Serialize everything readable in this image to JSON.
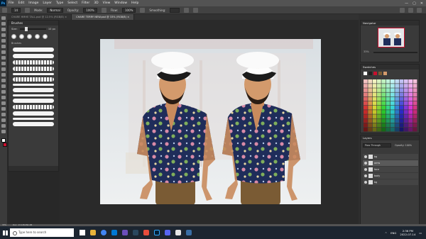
{
  "app": {
    "logo": "Ps",
    "menu": [
      "File",
      "Edit",
      "Image",
      "Layer",
      "Type",
      "Select",
      "Filter",
      "3D",
      "View",
      "Window",
      "Help"
    ],
    "window_controls": [
      "—",
      "▢",
      "✕"
    ]
  },
  "options_bar": {
    "size": "14",
    "mode_label": "Mode:",
    "mode_value": "Normal",
    "opacity_label": "Opacity:",
    "opacity_value": "100%",
    "flow_label": "Flow:",
    "flow_value": "100%",
    "smoothing_label": "Smoothing:"
  },
  "tabs": [
    {
      "label": "CHARE HMHE TALL.psd @ 12.5% (RGB/8) ×",
      "active": false
    },
    {
      "label": "CHARE TERRY NEW.psd @ 33% (RGB/8) ×",
      "active": true
    }
  ],
  "brushes_panel": {
    "title": "Brushes",
    "size_label": "Size:",
    "size_value": "10 px",
    "group_label": "Brushes"
  },
  "navigator": {
    "title": "Navigator",
    "zoom": "33%"
  },
  "swatches": {
    "title": "Swatches"
  },
  "layers": {
    "title": "Layers",
    "blend_mode": "Pass Through",
    "opacity_label": "Opacity: 100%",
    "items": [
      {
        "name": "bg",
        "active": false
      },
      {
        "name": "arms",
        "active": true
      },
      {
        "name": "face",
        "active": false
      },
      {
        "name": "body",
        "active": false
      },
      {
        "name": "bg",
        "active": false
      }
    ]
  },
  "status_bar": {
    "zoom": "33%",
    "doc_info": "Doc: 13.1M/266.4M"
  },
  "taskbar": {
    "search_placeholder": "Type here to search",
    "language": "ENG",
    "time": "2:36 PM",
    "date": "2022-07-14"
  }
}
